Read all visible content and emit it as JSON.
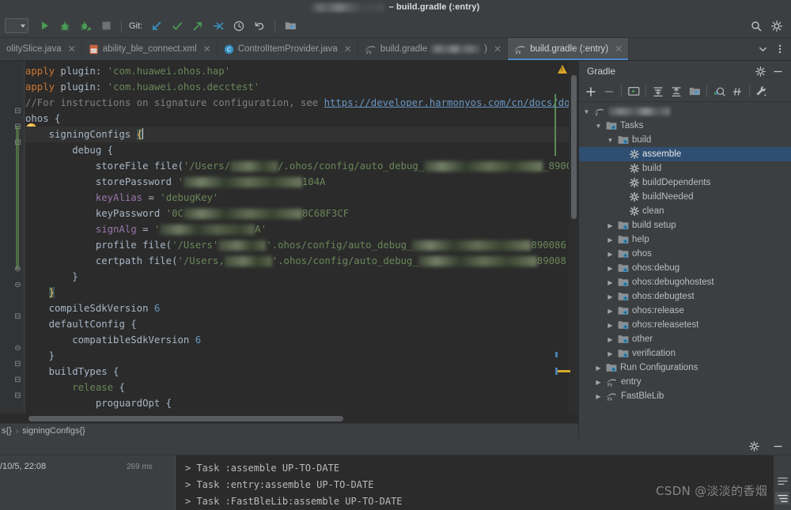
{
  "window": {
    "title_suffix": "– build.gradle (:entry)",
    "title_redacted": true
  },
  "toolbar": {
    "module_selector": "",
    "git_label": "Git:",
    "buttons": [
      {
        "name": "run-button",
        "icon": "play-icon",
        "label": "Run"
      },
      {
        "name": "debug-button",
        "icon": "bug-icon",
        "label": "Debug"
      },
      {
        "name": "run-coverage-button",
        "icon": "bug-arrow-icon",
        "label": "Run with Coverage"
      },
      {
        "name": "stop-button",
        "icon": "stop-square-icon",
        "label": "Stop"
      },
      {
        "name": "git-update-button",
        "icon": "arrow-down-left-icon",
        "label": "Update Project"
      },
      {
        "name": "git-commit-button",
        "icon": "check-icon",
        "label": "Commit"
      },
      {
        "name": "git-push-button",
        "icon": "arrow-up-right-icon",
        "label": "Push"
      },
      {
        "name": "git-pull-button",
        "icon": "arrows-merge-icon",
        "label": "Pull"
      },
      {
        "name": "git-history-button",
        "icon": "clock-icon",
        "label": "History"
      },
      {
        "name": "git-rollback-button",
        "icon": "undo-icon",
        "label": "Rollback"
      },
      {
        "name": "device-manager-button",
        "icon": "device-folder-icon",
        "label": "Device Manager"
      }
    ],
    "search_icon": "search-icon",
    "settings_icon": "gear-icon"
  },
  "tabs": {
    "items": [
      {
        "label": "olitySlice.java",
        "icon": "java-file-icon",
        "active": false,
        "truncated": true
      },
      {
        "label": "ability_ble_connect.xml",
        "icon": "xml-file-icon",
        "active": false
      },
      {
        "label": "ControlItemProvider.java",
        "icon": "class-file-icon",
        "active": false
      },
      {
        "label": "build.gradle",
        "icon": "gradle-file-icon",
        "active": false,
        "redacted_suffix": true,
        "trailing": ")"
      },
      {
        "label": "build.gradle (:entry)",
        "icon": "gradle-file-icon",
        "active": true
      }
    ],
    "overflow_icon": "chevron-down-icon",
    "more_icon": "more-vertical-icon"
  },
  "editor": {
    "lines": [
      {
        "id": 1,
        "segments": [
          {
            "t": "apply",
            "c": "kw"
          },
          {
            "t": " plugin: ",
            "c": "plain"
          },
          {
            "t": "'com.huawei.ohos.hap'",
            "c": "str"
          }
        ]
      },
      {
        "id": 2,
        "segments": [
          {
            "t": "apply",
            "c": "kw"
          },
          {
            "t": " plugin: ",
            "c": "plain"
          },
          {
            "t": "'com.huawei.ohos.decctest'",
            "c": "str"
          }
        ]
      },
      {
        "id": 3,
        "segments": [
          {
            "t": "//For instructions on signature configuration, see ",
            "c": "cmt"
          },
          {
            "t": "https://developer.harmonyos.com/cn/docs/documen",
            "c": "lnk"
          }
        ]
      },
      {
        "id": 4,
        "segments": [
          {
            "t": "ohos {",
            "c": "plain"
          }
        ]
      },
      {
        "id": 5,
        "highlight": true,
        "segments": [
          {
            "t": "    signingConfigs ",
            "c": "plain"
          },
          {
            "t": "{",
            "c": "brc"
          },
          {
            "t": "CURSOR",
            "c": "cursor"
          }
        ]
      },
      {
        "id": 6,
        "segments": [
          {
            "t": "        debug {",
            "c": "plain"
          }
        ]
      },
      {
        "id": 7,
        "segments": [
          {
            "t": "            storeFile file(",
            "c": "plain"
          },
          {
            "t": "'/Users/",
            "c": "str"
          },
          {
            "t": "REDACT1",
            "c": "redact"
          },
          {
            "t": "/.ohos/config/auto_debug_",
            "c": "str"
          },
          {
            "t": "REDACT2",
            "c": "redact"
          },
          {
            "t": "_8900",
            "c": "str"
          }
        ]
      },
      {
        "id": 8,
        "segments": [
          {
            "t": "            storePassword ",
            "c": "plain"
          },
          {
            "t": "'",
            "c": "str"
          },
          {
            "t": "REDACT2",
            "c": "redact"
          },
          {
            "t": "104A",
            "c": "str"
          }
        ]
      },
      {
        "id": 9,
        "segments": [
          {
            "t": "            keyAlias",
            "c": "attr"
          },
          {
            "t": " = ",
            "c": "plain"
          },
          {
            "t": "'debugKey'",
            "c": "str"
          }
        ]
      },
      {
        "id": 10,
        "segments": [
          {
            "t": "            keyPassword ",
            "c": "plain"
          },
          {
            "t": "'0C",
            "c": "str"
          },
          {
            "t": "REDACT2",
            "c": "redact"
          },
          {
            "t": "8C68F3CF",
            "c": "str"
          }
        ]
      },
      {
        "id": 11,
        "segments": [
          {
            "t": "            signAlg",
            "c": "attr"
          },
          {
            "t": " = ",
            "c": "plain"
          },
          {
            "t": "'",
            "c": "str"
          },
          {
            "t": "REDACT3",
            "c": "redact"
          },
          {
            "t": "A'",
            "c": "str"
          }
        ]
      },
      {
        "id": 12,
        "segments": [
          {
            "t": "            profile file(",
            "c": "plain"
          },
          {
            "t": "'/Users'",
            "c": "str"
          },
          {
            "t": "REDACT1",
            "c": "redact"
          },
          {
            "t": "'.ohos/config/auto_debug_",
            "c": "str"
          },
          {
            "t": "REDACT2",
            "c": "redact"
          },
          {
            "t": "890086",
            "c": "str"
          }
        ]
      },
      {
        "id": 13,
        "segments": [
          {
            "t": "            certpath file(",
            "c": "plain"
          },
          {
            "t": "'/Users,",
            "c": "str"
          },
          {
            "t": "REDACT1",
            "c": "redact"
          },
          {
            "t": "'.ohos/config/auto_debug_",
            "c": "str"
          },
          {
            "t": "REDACT2",
            "c": "redact"
          },
          {
            "t": "89008",
            "c": "str"
          }
        ]
      },
      {
        "id": 14,
        "segments": [
          {
            "t": "        }",
            "c": "plain"
          }
        ]
      },
      {
        "id": 15,
        "segments": [
          {
            "t": "    ",
            "c": "plain"
          },
          {
            "t": "}",
            "c": "brc-hl"
          }
        ]
      },
      {
        "id": 16,
        "segments": [
          {
            "t": "    compileSdkVersion ",
            "c": "plain"
          },
          {
            "t": "6",
            "c": "num"
          }
        ]
      },
      {
        "id": 17,
        "segments": [
          {
            "t": "    defaultConfig {",
            "c": "plain"
          }
        ]
      },
      {
        "id": 18,
        "segments": [
          {
            "t": "        compatibleSdkVersion ",
            "c": "plain"
          },
          {
            "t": "6",
            "c": "num"
          }
        ]
      },
      {
        "id": 19,
        "segments": [
          {
            "t": "    }",
            "c": "plain"
          }
        ]
      },
      {
        "id": 20,
        "segments": [
          {
            "t": "    buildTypes {",
            "c": "plain"
          }
        ]
      },
      {
        "id": 21,
        "segments": [
          {
            "t": "        release",
            "c": "str"
          },
          {
            "t": " {",
            "c": "plain"
          }
        ]
      },
      {
        "id": 22,
        "segments": [
          {
            "t": "            proguardOpt {",
            "c": "plain"
          }
        ]
      }
    ],
    "warning_icon": "warning-triangle-icon",
    "inspection_bulb_icon": "lightbulb-icon"
  },
  "breadcrumb": {
    "prefix": "s{}",
    "separator": "›",
    "current": "signingConfigs{}"
  },
  "gradle": {
    "title": "Gradle",
    "settings_icon": "gear-icon",
    "minimize_icon": "minimize-icon",
    "toolbar": [
      {
        "name": "link-gradle-project-button",
        "icon": "plus-icon"
      },
      {
        "name": "unlink-gradle-project-button",
        "icon": "minus-icon"
      },
      {
        "name": "execute-gradle-task-button",
        "icon": "run-task-icon"
      },
      {
        "name": "expand-all-button",
        "icon": "expand-all-icon"
      },
      {
        "name": "collapse-all-button",
        "icon": "collapse-all-icon"
      },
      {
        "name": "show-modules-button",
        "icon": "modules-icon"
      },
      {
        "name": "toggle-offline-button",
        "icon": "offline-icon"
      },
      {
        "name": "skip-tests-button",
        "icon": "skip-tests-icon"
      },
      {
        "name": "build-tool-settings-button",
        "icon": "wrench-icon"
      }
    ],
    "tree": [
      {
        "label": "",
        "depth": 0,
        "expanded": true,
        "icon": "gradle-project-icon",
        "redacted": true
      },
      {
        "label": "Tasks",
        "depth": 1,
        "expanded": true,
        "icon": "task-folder-icon"
      },
      {
        "label": "build",
        "depth": 2,
        "expanded": true,
        "icon": "task-folder-icon"
      },
      {
        "label": "assemble",
        "depth": 3,
        "leaf": true,
        "icon": "gear-task-icon",
        "selected": true
      },
      {
        "label": "build",
        "depth": 3,
        "leaf": true,
        "icon": "gear-task-icon"
      },
      {
        "label": "buildDependents",
        "depth": 3,
        "leaf": true,
        "icon": "gear-task-icon"
      },
      {
        "label": "buildNeeded",
        "depth": 3,
        "leaf": true,
        "icon": "gear-task-icon"
      },
      {
        "label": "clean",
        "depth": 3,
        "leaf": true,
        "icon": "gear-task-icon"
      },
      {
        "label": "build setup",
        "depth": 2,
        "expanded": false,
        "icon": "task-folder-icon"
      },
      {
        "label": "help",
        "depth": 2,
        "expanded": false,
        "icon": "task-folder-icon"
      },
      {
        "label": "ohos",
        "depth": 2,
        "expanded": false,
        "icon": "task-folder-icon"
      },
      {
        "label": "ohos:debug",
        "depth": 2,
        "expanded": false,
        "icon": "task-folder-icon"
      },
      {
        "label": "ohos:debugohostest",
        "depth": 2,
        "expanded": false,
        "icon": "task-folder-icon"
      },
      {
        "label": "ohos:debugtest",
        "depth": 2,
        "expanded": false,
        "icon": "task-folder-icon"
      },
      {
        "label": "ohos:release",
        "depth": 2,
        "expanded": false,
        "icon": "task-folder-icon"
      },
      {
        "label": "ohos:releasetest",
        "depth": 2,
        "expanded": false,
        "icon": "task-folder-icon"
      },
      {
        "label": "other",
        "depth": 2,
        "expanded": false,
        "icon": "task-folder-icon"
      },
      {
        "label": "verification",
        "depth": 2,
        "expanded": false,
        "icon": "task-folder-icon"
      },
      {
        "label": "Run Configurations",
        "depth": 1,
        "expanded": false,
        "icon": "task-folder-icon"
      },
      {
        "label": "entry",
        "depth": 1,
        "expanded": false,
        "icon": "gradle-module-icon"
      },
      {
        "label": "FastBleLib",
        "depth": 1,
        "expanded": false,
        "icon": "gradle-module-icon"
      }
    ]
  },
  "console": {
    "settings_icon": "gear-icon",
    "minimize_icon": "minimize-icon",
    "timestamp": "/10/5, 22:08",
    "duration": "269 ms",
    "output": [
      "> Task :assemble UP-TO-DATE",
      "> Task :entry:assemble UP-TO-DATE",
      "> Task :FastBleLib:assemble UP-TO-DATE"
    ],
    "side_buttons": [
      {
        "name": "console-toggle-tasks-button",
        "icon": "list-icon"
      },
      {
        "name": "console-toggle-tree-button",
        "icon": "tree-icon"
      }
    ]
  },
  "watermark": "CSDN @淡淡的香烟",
  "colors": {
    "accent": "#4a88c7",
    "selection": "#2f4f72",
    "editor_bg": "#2b2b2b",
    "chrome_bg": "#3c3f41",
    "string": "#6a8759",
    "keyword": "#cc7832",
    "number": "#6897bb",
    "comment": "#808080",
    "change_bar": "#4d6b41"
  }
}
